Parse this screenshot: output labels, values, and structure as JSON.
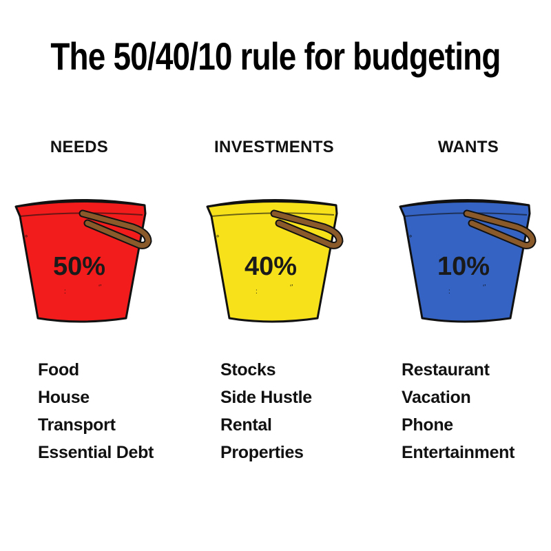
{
  "title": "The 50/40/10 rule for budgeting",
  "columns": [
    {
      "label": "NEEDS",
      "percent": "50%",
      "color": "#f21c1c",
      "items": [
        "Food",
        "House",
        "Transport",
        "Essential Debt"
      ]
    },
    {
      "label": "INVESTMENTS",
      "percent": "40%",
      "color": "#f7e11a",
      "items": [
        "Stocks",
        "Side Hustle",
        "Rental",
        "Properties"
      ]
    },
    {
      "label": "WANTS",
      "percent": "10%",
      "color": "#3463c4",
      "items": [
        "Restaurant",
        "Vacation",
        "Phone",
        "Entertainment"
      ]
    }
  ],
  "colors": {
    "handle": "#8b5a2b",
    "outline": "#111111"
  }
}
